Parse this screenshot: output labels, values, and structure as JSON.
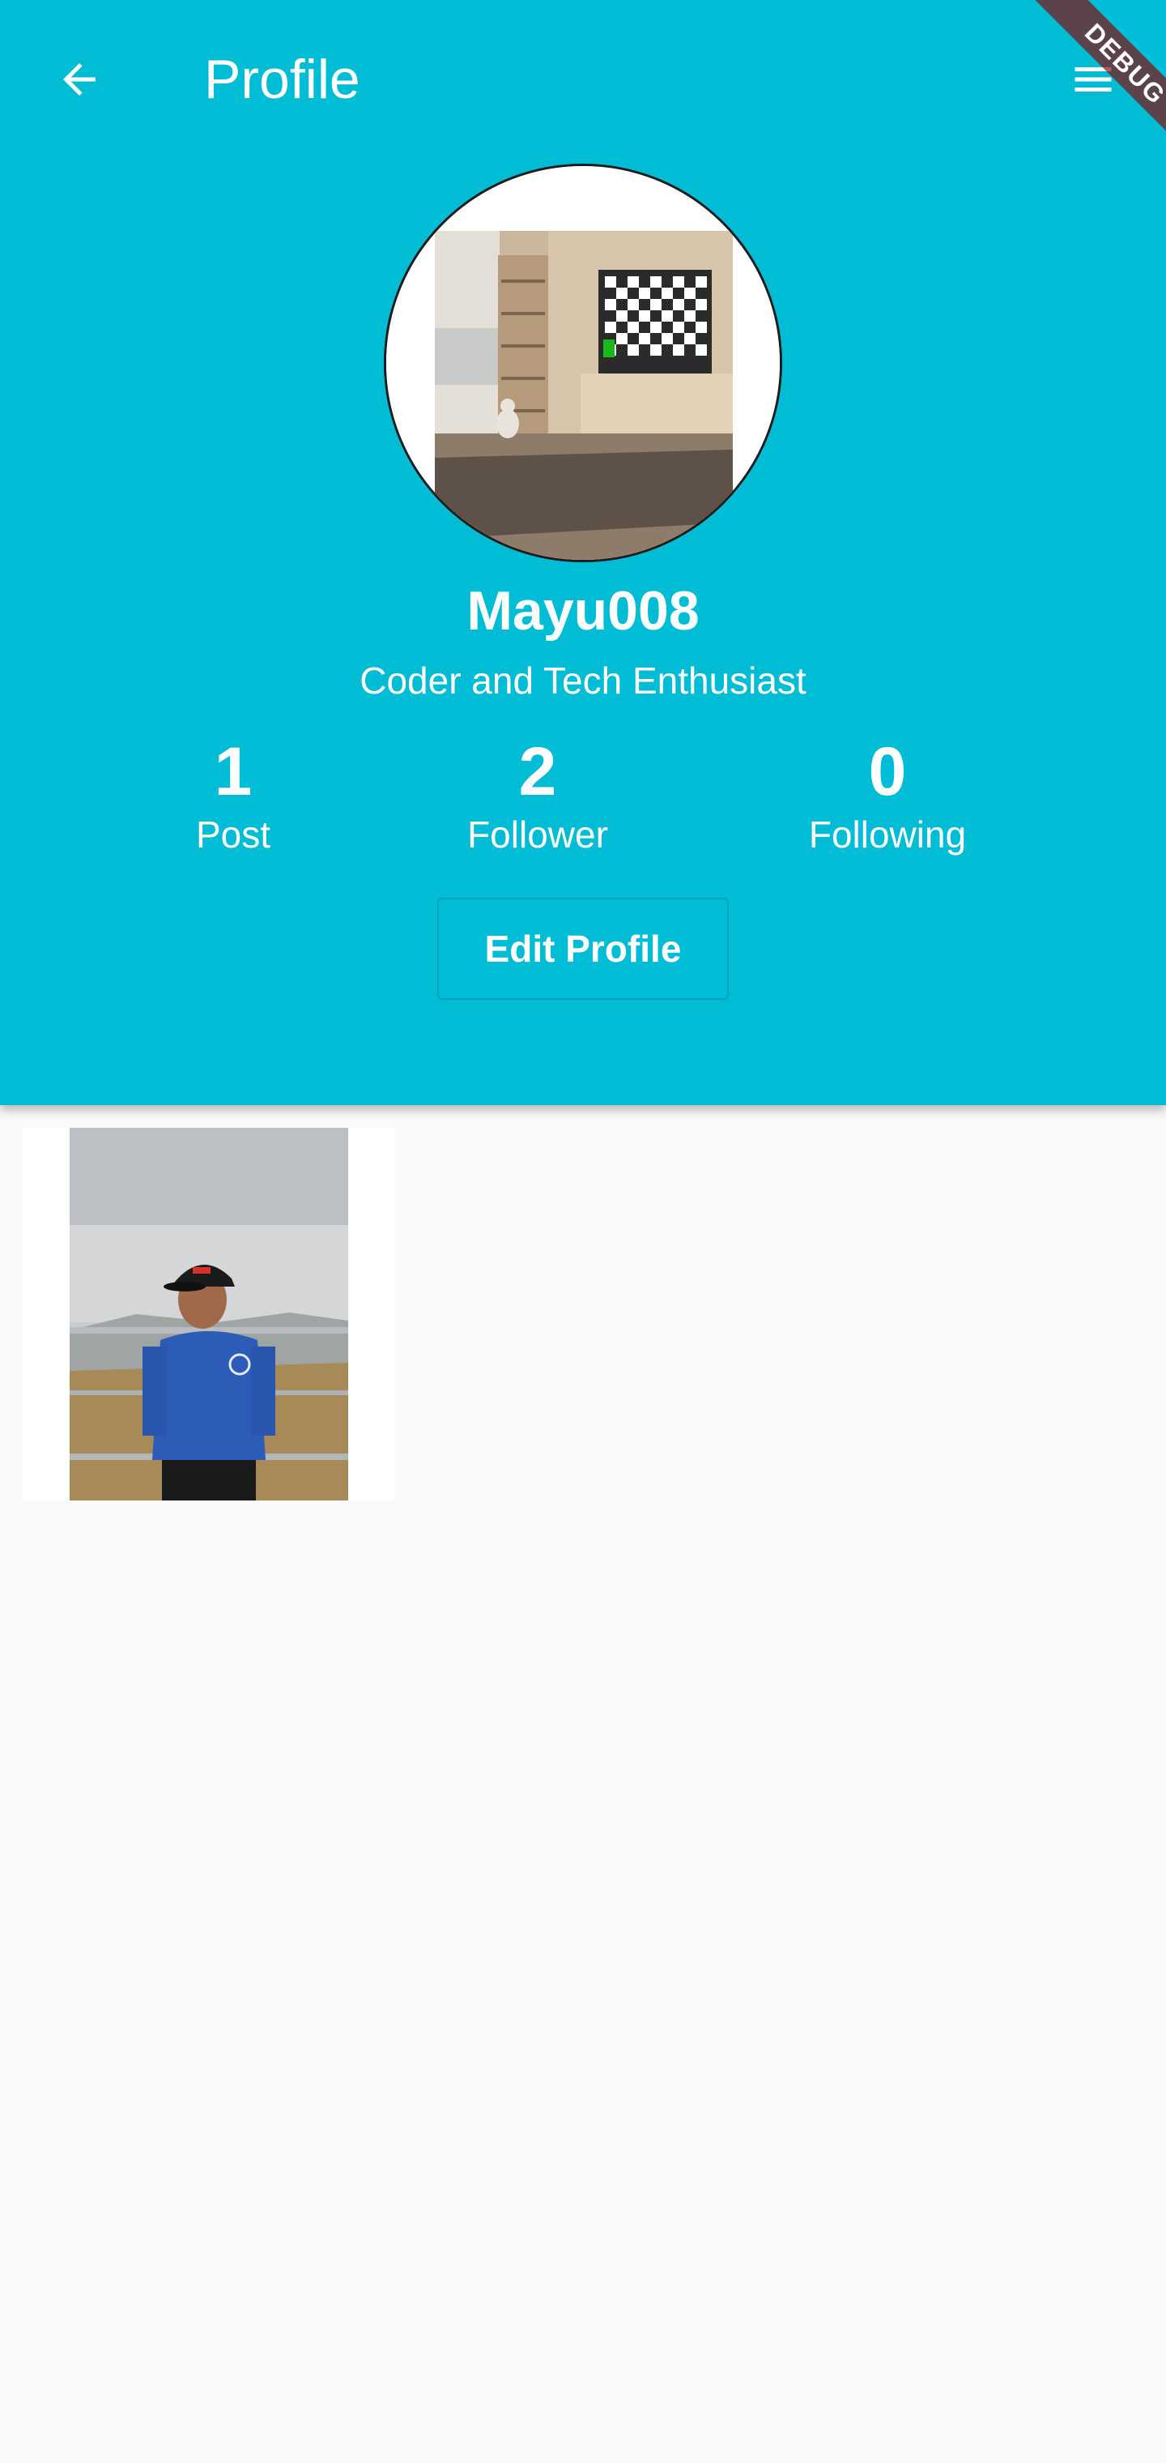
{
  "appbar": {
    "title": "Profile",
    "back_icon": "arrow-back-icon",
    "menu_icon": "menu-icon"
  },
  "debug_banner": "DEBUG",
  "profile": {
    "username": "Mayu008",
    "bio": "Coder and Tech Enthusiast",
    "avatar": "living-room-photo"
  },
  "stats": [
    {
      "value": "1",
      "label": "Post"
    },
    {
      "value": "2",
      "label": "Follower"
    },
    {
      "value": "0",
      "label": "Following"
    }
  ],
  "edit_button": "Edit Profile",
  "posts": [
    {
      "image": "man-blue-hoodie-photo"
    }
  ],
  "colors": {
    "header": "#00bcd4",
    "background": "#fafafa",
    "text": "#ffffff"
  }
}
